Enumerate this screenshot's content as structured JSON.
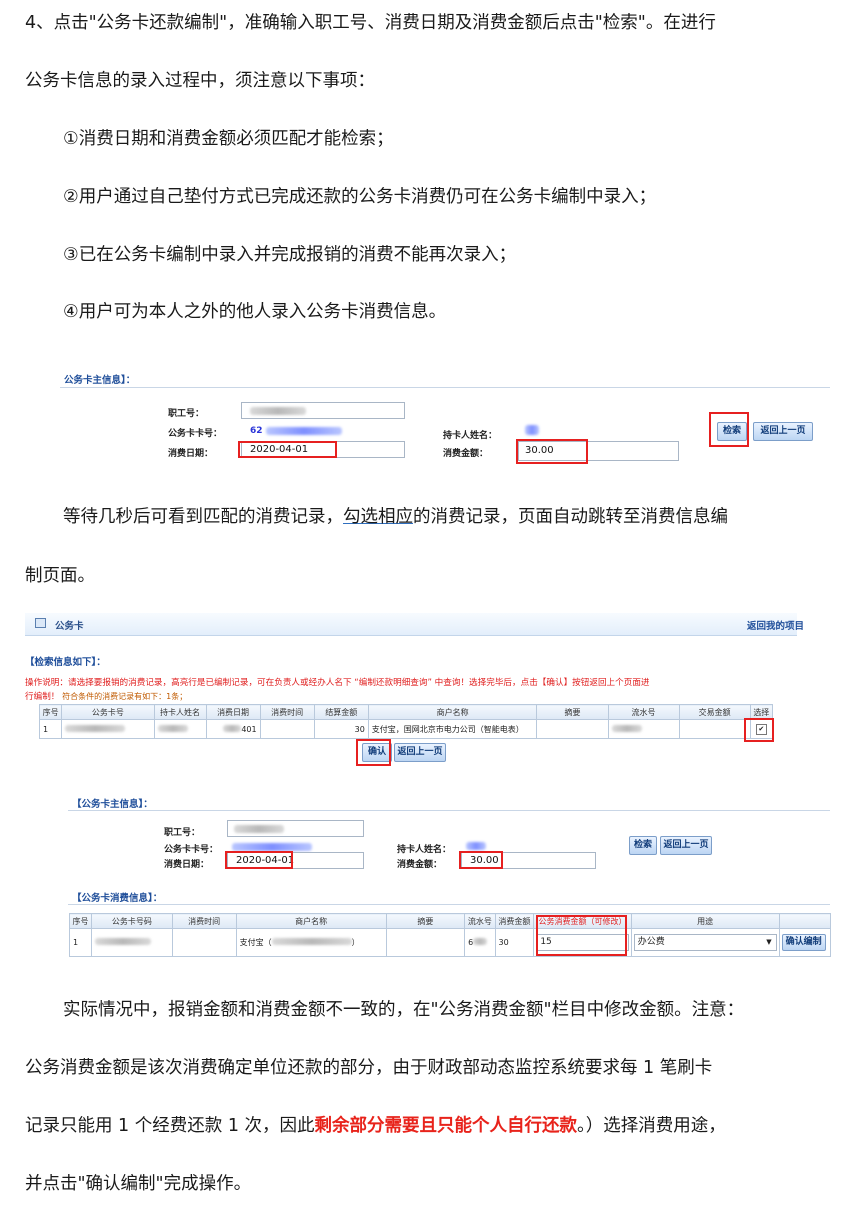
{
  "intro": {
    "line1": "4、点击\"公务卡还款编制\"，准确输入职工号、消费日期及消费金额后点击\"检索\"。在进行",
    "line2": "公务卡信息的录入过程中，须注意以下事项：",
    "items": [
      "①消费日期和消费金额必须匹配才能检索；",
      "②用户通过自己垫付方式已完成还款的公务卡消费仍可在公务卡编制中录入；",
      "③已在公务卡编制中录入并完成报销的消费不能再次录入；",
      "④用户可为本人之外的他人录入公务卡消费信息。"
    ]
  },
  "search_form": {
    "section_title": "公务卡主信息】：",
    "employee_id_label": "职工号：",
    "card_no_label": "公务卡卡号：",
    "card_no_prefix": "62",
    "date_label": "消费日期：",
    "date_value": "2020-04-01",
    "holder_label": "持卡人姓名：",
    "amount_label": "消费金额：",
    "amount_value": "30.00",
    "search_button": "检索",
    "back_button": "返回上一页"
  },
  "middle": {
    "line1_a": "等待几秒后可看到匹配的消费记录，",
    "line1_b": "勾选相应",
    "line1_c": "的消费记录，页面自动跳转至消费信息编",
    "line2": "制页面。"
  },
  "result_panel": {
    "tab_title": "公务卡",
    "back_link": "返回我的项目",
    "section_title": "【检索信息如下】：",
    "notice_line1": "操作说明：请选择要报销的消费记录，高亮行是已编制记录，可在负责人或经办人名下 “编制还款明细查询” 中查询！选择完毕后，点击【确认】按钮返回上个页面进",
    "notice_line2_a": "行编制！",
    "notice_line2_b": "符合条件的消费记录有如下：1条；",
    "columns": [
      "序号",
      "公务卡号",
      "持卡人姓名",
      "消费日期",
      "消费时间",
      "结算金额",
      "商户名称",
      "摘要",
      "流水号",
      "交易金额",
      "选择"
    ],
    "row": {
      "index": "1",
      "date_suffix": "401",
      "amount": "30",
      "merchant": "支付宝，国网北京市电力公司（智能电表）",
      "checkbox": "✔"
    },
    "confirm_button": "确认",
    "back_button": "返回上一页"
  },
  "edit_panel": {
    "section_title": "【公务卡主信息】：",
    "employee_id_label": "职工号：",
    "card_no_label": "公务卡卡号：",
    "date_label": "消费日期：",
    "date_value": "2020-04-01",
    "holder_label": "持卡人姓名：",
    "amount_label": "消费金额：",
    "amount_value": "30.00",
    "search_button": "检索",
    "back_button": "返回上一页",
    "consume_title": "【公务卡消费信息】：",
    "columns": [
      "序号",
      "公务卡号码",
      "消费时间",
      "商户名称",
      "摘要",
      "流水号",
      "消费金额",
      "公务消费金额（可修改）",
      "用途"
    ],
    "row": {
      "index": "1",
      "merchant_prefix": "支付宝（",
      "merchant_suffix": "）",
      "serial_prefix": "6",
      "amount": "30",
      "official_amount": "15",
      "purpose": "办公费",
      "confirm_edit": "确认编制"
    }
  },
  "outro": {
    "line1": "实际情况中，报销金额和消费金额不一致的，在\"公务消费金额\"栏目中修改金额。注意：",
    "line2": "公务消费金额是该次消费确定单位还款的部分，由于财政部动态监控系统要求每 1 笔刷卡",
    "line3_a": "记录只能用 1 个经费还款 1 次，因此",
    "line3_b": "剩余部分需要且只能个人自行还款",
    "line3_c": "。）选择消费用途，",
    "line4": "并点击\"确认编制\"完成操作。"
  },
  "colors": {
    "highlight_red": "#e8231b",
    "header_blue": "#1f4e9a",
    "notice_red": "#e02020"
  }
}
